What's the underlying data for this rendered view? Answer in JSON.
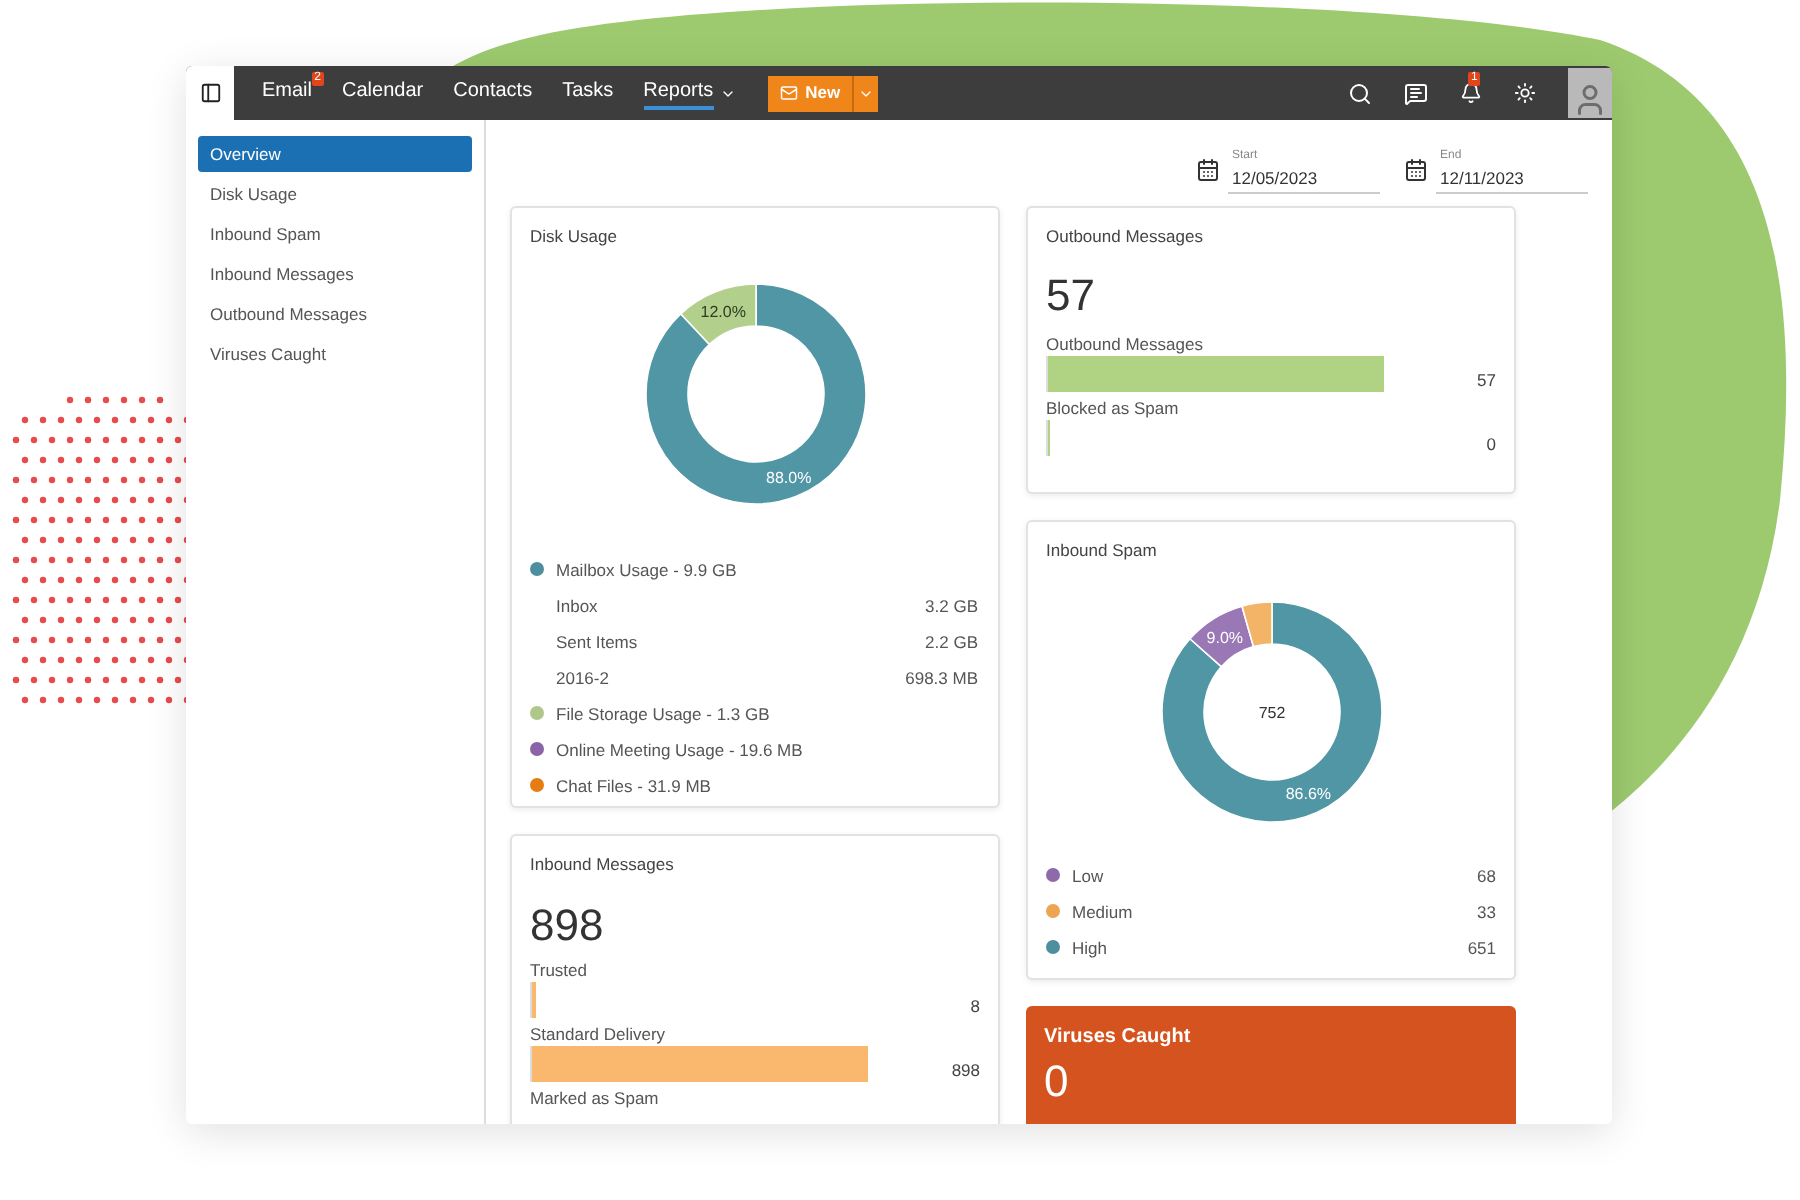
{
  "nav": {
    "items": [
      {
        "label": "Email",
        "selected": false,
        "badge": "2",
        "dropdown": false
      },
      {
        "label": "Calendar",
        "selected": false,
        "dropdown": false
      },
      {
        "label": "Contacts",
        "selected": false,
        "dropdown": false
      },
      {
        "label": "Tasks",
        "selected": false,
        "dropdown": false
      },
      {
        "label": "Reports",
        "selected": true,
        "dropdown": true
      }
    ],
    "new_button": "New",
    "notification_badge": "1"
  },
  "sidebar": {
    "items": [
      {
        "label": "Overview",
        "selected": true
      },
      {
        "label": "Disk Usage",
        "selected": false
      },
      {
        "label": "Inbound Spam",
        "selected": false
      },
      {
        "label": "Inbound Messages",
        "selected": false
      },
      {
        "label": "Outbound Messages",
        "selected": false
      },
      {
        "label": "Viruses Caught",
        "selected": false
      }
    ]
  },
  "date_range": {
    "start": {
      "label": "Start",
      "value": "12/05/2023"
    },
    "end": {
      "label": "End",
      "value": "12/11/2023"
    }
  },
  "disk_usage": {
    "title": "Disk Usage",
    "chart_data": {
      "type": "donut",
      "series": [
        {
          "values": [
            88.0,
            12.0
          ]
        }
      ],
      "colors": [
        "#5096a5",
        "#b3cf8c"
      ],
      "value_labels": [
        "88.0%",
        "12.0%"
      ]
    },
    "legend": [
      {
        "label": "Mailbox Usage - 9.9 GB",
        "color": "#4e8f9f",
        "children": [
          {
            "name": "Inbox",
            "value": "3.2 GB"
          },
          {
            "name": "Sent Items",
            "value": "2.2 GB"
          },
          {
            "name": "2016-2",
            "value": "698.3 MB"
          }
        ]
      },
      {
        "label": "File Storage Usage - 1.3 GB",
        "color": "#aec88b"
      },
      {
        "label": "Online Meeting Usage - 19.6 MB",
        "color": "#8a63a8"
      },
      {
        "label": "Chat Files - 31.9 MB",
        "color": "#e57d14"
      }
    ]
  },
  "outbound": {
    "title": "Outbound Messages",
    "total": "57",
    "bars": [
      {
        "label": "Outbound Messages",
        "value": "57",
        "level": 1.0
      },
      {
        "label": "Blocked as Spam",
        "value": "0",
        "level": 0.0
      }
    ]
  },
  "inbound_spam": {
    "title": "Inbound Spam",
    "center": "752",
    "chart_data": {
      "type": "donut",
      "series": [
        {
          "values": [
            86.6,
            9.0,
            4.4
          ]
        }
      ],
      "colors": [
        "#5096a5",
        "#9a78b5",
        "#f4b467"
      ],
      "value_labels": [
        "86.6%",
        "9.0%",
        null
      ]
    },
    "legend": [
      {
        "label": "Low",
        "value": "68",
        "color": "#8d6bab"
      },
      {
        "label": "Medium",
        "value": "33",
        "color": "#eda453"
      },
      {
        "label": "High",
        "value": "651",
        "color": "#4e8f9f"
      }
    ]
  },
  "inbound_messages": {
    "title": "Inbound Messages",
    "total": "898",
    "bars": [
      {
        "label": "Trusted",
        "value": "8",
        "level": 0.009
      },
      {
        "label": "Standard Delivery",
        "value": "898",
        "level": 1.0
      },
      {
        "label": "Marked as Spam"
      }
    ]
  },
  "viruses": {
    "title": "Viruses Caught",
    "total": "0"
  }
}
